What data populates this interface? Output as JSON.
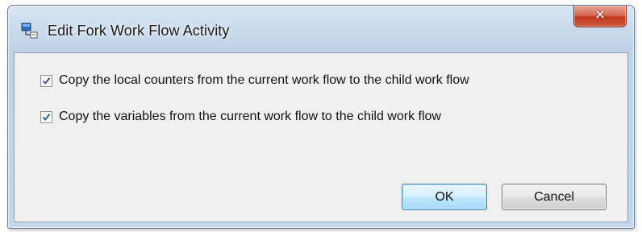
{
  "window": {
    "title": "Edit Fork Work Flow Activity",
    "icon": "workflow-icon",
    "close_glyph": "✕"
  },
  "options": [
    {
      "label": "Copy the local counters from the current work flow to the child work flow",
      "checked": true
    },
    {
      "label": "Copy the variables from the current work flow to the child work flow",
      "checked": true
    }
  ],
  "buttons": {
    "ok_label": "OK",
    "cancel_label": "Cancel"
  },
  "colors": {
    "title_bar": "#c8daec",
    "close_button": "#c0391f",
    "client_background": "#f0f0f0",
    "check_mark": "#3a5a86",
    "default_button_border": "#3c7fb1"
  }
}
